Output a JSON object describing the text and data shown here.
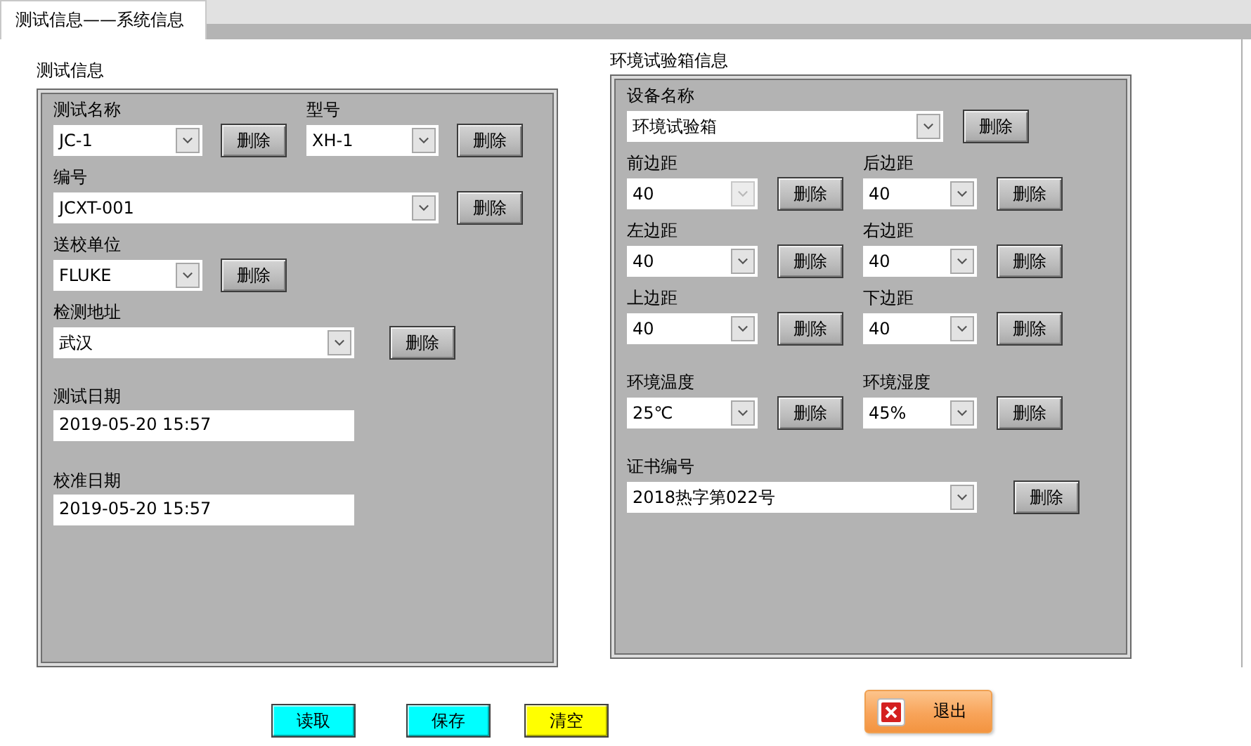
{
  "tabs": [
    {
      "label": "测试信息——系统信息",
      "selected": true
    }
  ],
  "panels": [
    {
      "title": "测试信息",
      "rows": [
        {
          "fields": [
            {
              "label": "测试名称",
              "kind": "combo",
              "value": "JC-1",
              "disabled": false,
              "button": "删除"
            },
            {
              "label": "型号",
              "kind": "combo",
              "value": "XH-1",
              "disabled": false,
              "button": "删除"
            }
          ]
        },
        {
          "fields": [
            {
              "label": "编号",
              "kind": "combo",
              "value": "JCXT-001",
              "disabled": false,
              "button": "删除"
            }
          ]
        },
        {
          "fields": [
            {
              "label": "送校单位",
              "kind": "combo",
              "value": "FLUKE",
              "disabled": false,
              "button": "删除"
            }
          ]
        },
        {
          "fields": [
            {
              "label": "检测地址",
              "kind": "combo",
              "value": "武汉",
              "disabled": false,
              "button": "删除"
            }
          ]
        },
        {
          "fields": [
            {
              "label": "测试日期",
              "kind": "text",
              "value": "2019-05-20 15:57",
              "disabled": false
            }
          ]
        },
        {
          "fields": [
            {
              "label": "校准日期",
              "kind": "text",
              "value": "2019-05-20 15:57",
              "disabled": false
            }
          ]
        }
      ]
    },
    {
      "title": "环境试验箱信息",
      "rows": [
        {
          "fields": [
            {
              "label": "设备名称",
              "kind": "combo",
              "value": "环境试验箱",
              "disabled": false,
              "button": "删除"
            }
          ]
        },
        {
          "fields": [
            {
              "label": "前边距",
              "kind": "combo",
              "value": "40",
              "disabled": true,
              "button": "删除"
            },
            {
              "label": "后边距",
              "kind": "combo",
              "value": "40",
              "disabled": false,
              "button": "删除"
            }
          ]
        },
        {
          "fields": [
            {
              "label": "左边距",
              "kind": "combo",
              "value": "40",
              "disabled": false,
              "button": "删除"
            },
            {
              "label": "右边距",
              "kind": "combo",
              "value": "40",
              "disabled": false,
              "button": "删除"
            }
          ]
        },
        {
          "fields": [
            {
              "label": "上边距",
              "kind": "combo",
              "value": "40",
              "disabled": false,
              "button": "删除"
            },
            {
              "label": "下边距",
              "kind": "combo",
              "value": "40",
              "disabled": false,
              "button": "删除"
            }
          ]
        },
        {
          "fields": [
            {
              "label": "环境温度",
              "kind": "combo",
              "value": "25℃",
              "disabled": false,
              "button": "删除"
            },
            {
              "label": "环境湿度",
              "kind": "combo",
              "value": "45%",
              "disabled": false,
              "button": "删除"
            }
          ]
        },
        {
          "fields": [
            {
              "label": "证书编号",
              "kind": "combo",
              "value": "2018热字第022号",
              "disabled": false,
              "button": "删除"
            }
          ]
        }
      ]
    }
  ],
  "actions": [
    {
      "label": "读取",
      "color": "#00ffff"
    },
    {
      "label": "保存",
      "color": "#00ffff"
    },
    {
      "label": "清空",
      "color": "#ffff00"
    }
  ],
  "exit_button": {
    "label": "退出"
  }
}
